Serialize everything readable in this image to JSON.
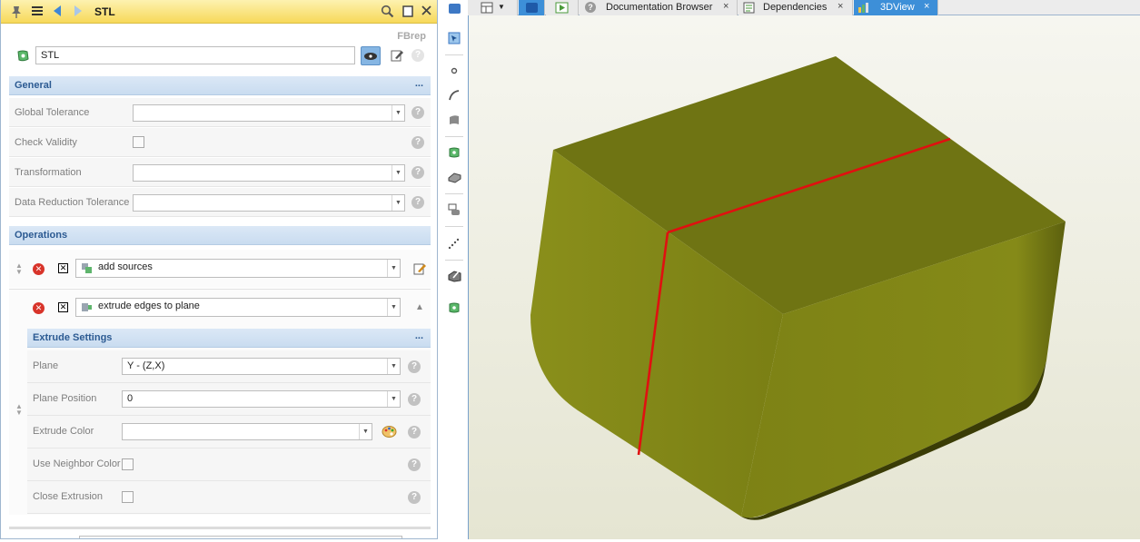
{
  "panel": {
    "title": "STL",
    "type_label": "FBrep",
    "name_value": "STL"
  },
  "general": {
    "title": "General",
    "more": "...",
    "rows": [
      {
        "label": "Global Tolerance",
        "value": ""
      },
      {
        "label": "Check Validity"
      },
      {
        "label": "Transformation",
        "value": ""
      },
      {
        "label": "Data Reduction Tolerance",
        "value": ""
      }
    ]
  },
  "operations": {
    "title": "Operations",
    "items": [
      {
        "label": "add sources"
      },
      {
        "label": "extrude edges to plane"
      }
    ]
  },
  "extrude_settings": {
    "title": "Extrude Settings",
    "more": "...",
    "plane_label": "Plane",
    "plane_value": "Y - (Z,X)",
    "plane_position_label": "Plane Position",
    "plane_position_value": "0",
    "extrude_color_label": "Extrude Color",
    "extrude_color_value": "",
    "use_neighbor_color_label": "Use Neighbor Color",
    "close_extrusion_label": "Close Extrusion"
  },
  "tabs": [
    {
      "label": "Documentation Browser",
      "close": "×"
    },
    {
      "label": "Dependencies",
      "close": "×"
    },
    {
      "label": "3DView",
      "close": "×",
      "active": true
    }
  ],
  "icons": {
    "pin": "pin-icon",
    "menu": "hamburger-icon",
    "back": "back-arrow-icon",
    "forward": "forward-arrow-icon",
    "search": "search-icon",
    "restore": "restore-icon",
    "close": "close-icon"
  },
  "colors": {
    "accent": "#3d8fd8",
    "section_title": "#2c5a92",
    "solid_top": "#6f7413",
    "solid_front": "#818716",
    "edge": "#e01010"
  }
}
